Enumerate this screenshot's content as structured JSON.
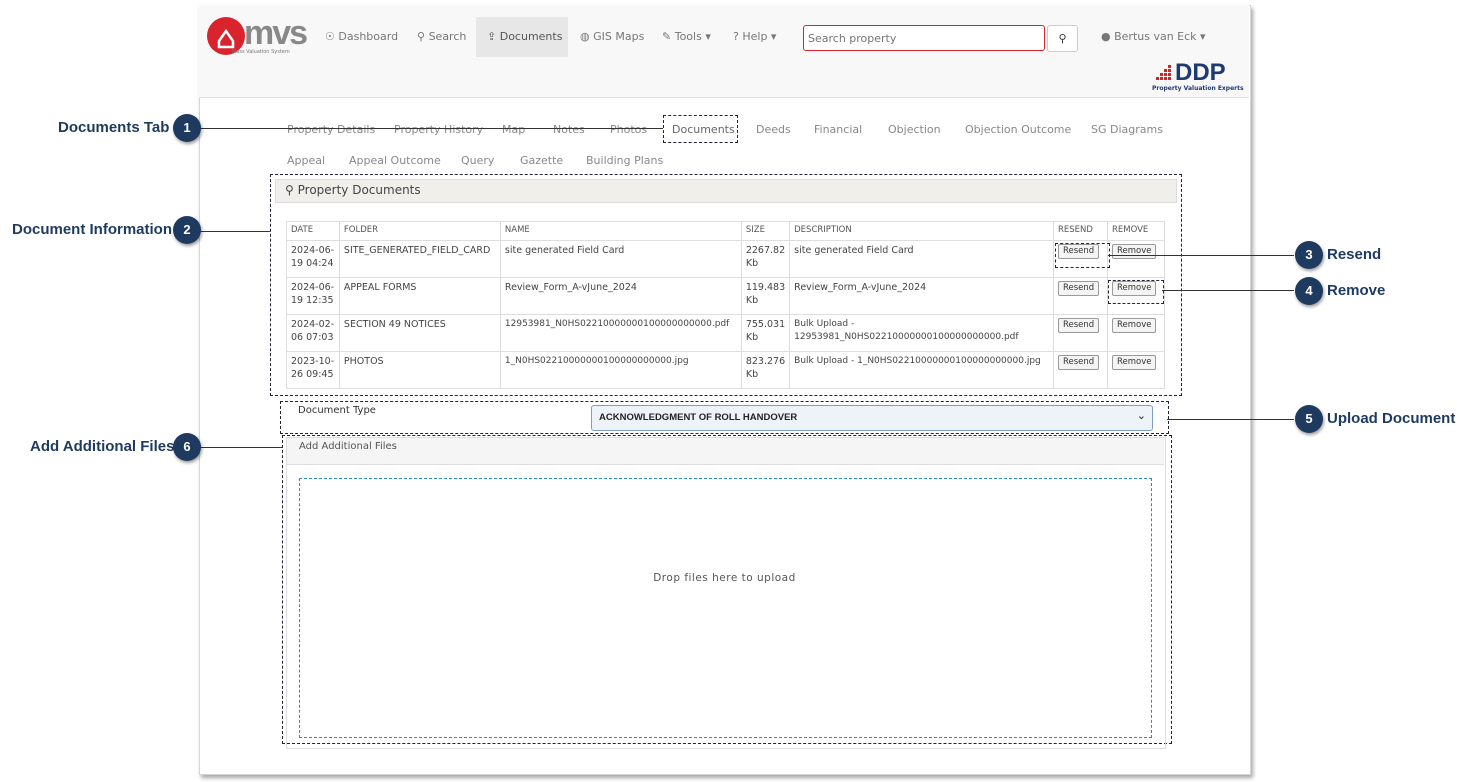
{
  "header": {
    "logo_text": "mvs",
    "logo_sub": "Mass Valuation System",
    "nav": [
      {
        "icon": "dashboard-icon",
        "label": "Dashboard",
        "glyph": "☉"
      },
      {
        "icon": "search-icon",
        "label": "Search",
        "glyph": "⚲"
      },
      {
        "icon": "upload-icon",
        "label": "Documents",
        "glyph": "⇪"
      },
      {
        "icon": "globe-icon",
        "label": "GIS Maps",
        "glyph": "◍"
      },
      {
        "icon": "wrench-icon",
        "label": "Tools",
        "glyph": "✎"
      },
      {
        "icon": "help-icon",
        "label": "Help",
        "glyph": "?"
      }
    ],
    "search_placeholder": "Search property",
    "user": "Bertus van Eck",
    "brand_text": "DDP",
    "brand_sub": "Property Valuation Experts",
    "accent_color": "#d9232d"
  },
  "tabs_row1": [
    "Property Details",
    "Property History",
    "Map",
    "Notes",
    "Photos",
    "Documents",
    "Deeds",
    "Financial",
    "Objection",
    "Objection Outcome",
    "SG Diagrams"
  ],
  "tabs_row2": [
    "Appeal",
    "Appeal Outcome",
    "Query",
    "Gazette",
    "Building Plans"
  ],
  "documents": {
    "heading": "Property Documents",
    "columns": [
      "DATE",
      "FOLDER",
      "NAME",
      "SIZE",
      "DESCRIPTION",
      "RESEND",
      "REMOVE"
    ],
    "rows": [
      {
        "date": "2024-06-19 04:24",
        "folder": "SITE_GENERATED_FIELD_CARD",
        "name": "site generated Field Card",
        "size": "2267.82 Kb",
        "description": "site generated Field Card"
      },
      {
        "date": "2024-06-19 12:35",
        "folder": "APPEAL FORMS",
        "name": "Review_Form_A-vJune_2024",
        "size": "119.483 Kb",
        "description": "Review_Form_A-vJune_2024"
      },
      {
        "date": "2024-02-06 07:03",
        "folder": "SECTION 49 NOTICES",
        "name": "12953981_N0HS02210000000100000000000.pdf",
        "size": "755.031 Kb",
        "description": "Bulk Upload - 12953981_N0HS02210000000100000000000.pdf"
      },
      {
        "date": "2023-10-26 09:45",
        "folder": "PHOTOS",
        "name": "1_N0HS02210000000100000000000.jpg",
        "size": "823.276 Kb",
        "description": "Bulk Upload - 1_N0HS02210000000100000000000.jpg"
      }
    ],
    "resend_label": "Resend",
    "remove_label": "Remove"
  },
  "upload": {
    "doc_type_label": "Document Type",
    "doc_type_value": "ACKNOWLEDGMENT OF ROLL HANDOVER",
    "add_files_heading": "Add Additional Files",
    "drop_text": "Drop files here to upload"
  },
  "callouts": [
    {
      "num": "1",
      "label": "Documents Tab"
    },
    {
      "num": "2",
      "label": "Document Information"
    },
    {
      "num": "3",
      "label": "Resend"
    },
    {
      "num": "4",
      "label": "Remove"
    },
    {
      "num": "5",
      "label": "Upload Document"
    },
    {
      "num": "6",
      "label": "Add Additional Files"
    }
  ]
}
